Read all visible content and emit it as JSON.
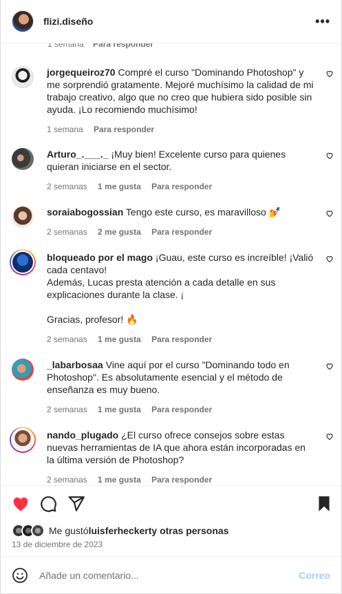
{
  "header": {
    "username": "flizi.diseño",
    "more_icon": "more-horizontal-icon"
  },
  "partial_comment": {
    "time": "1 semana",
    "reply": "Para responder"
  },
  "comments": [
    {
      "user": "jorgequeiroz70",
      "text": "Compré el curso \"Dominando Photoshop\" y me sorprendió gratamente. Mejoré muchísimo la calidad de mi trabajo creativo, algo que no creo que hubiera sido posible sin ayuda. ¡Lo recomiendo muchísimo!",
      "time": "1 semana",
      "likes": "",
      "reply": "Para responder"
    },
    {
      "user": "Arturo_.___._",
      "text": "¡Muy bien! Excelente curso para quienes quieran iniciarse en el sector.",
      "time": "2 semanas",
      "likes": "1 me gusta",
      "reply": "Para responder"
    },
    {
      "user": "soraiabogossian",
      "text": "Tengo este curso, es maravilloso 💅",
      "time": "2 semanas",
      "likes": "2 me gusta",
      "reply": "Para responder"
    },
    {
      "user": "bloqueado por el mago",
      "text": "¡Guau, este curso es increíble! ¡Valió cada centavo!\nAdemás, Lucas presta atención a cada detalle en sus explicaciones durante la clase. ¡\n\nGracias, profesor! 🔥",
      "time": "2 semanas",
      "likes": "1 me gusta",
      "reply": "Para responder"
    },
    {
      "user": "_labarbosaa",
      "text": "Vine aquí por el curso \"Dominando todo en Photoshop\". Es absolutamente esencial y el método de enseñanza es muy bueno.",
      "time": "2 semanas",
      "likes": "1 me gusta",
      "reply": "Para responder"
    },
    {
      "user": "nando_plugado",
      "text": "¿El curso ofrece consejos sobre estas nuevas herramientas de IA que ahora están incorporadas en la última versión de Photoshop?",
      "time": "2 semanas",
      "likes": "1 me gusta",
      "reply": "Para responder"
    }
  ],
  "actions": {
    "like_icon": "heart-filled-icon",
    "comment_icon": "comment-icon",
    "share_icon": "share-icon",
    "save_icon": "bookmark-icon",
    "like_color": "#ff3040"
  },
  "likes": {
    "prefix": "Me gustó",
    "user": "luisferheckert",
    "suffix": "y otras personas"
  },
  "date": "13 de diciembre de 2023",
  "comment_box": {
    "placeholder": "Añade un comentario...",
    "post_label": "Correo",
    "emoji_icon": "emoji-icon"
  }
}
